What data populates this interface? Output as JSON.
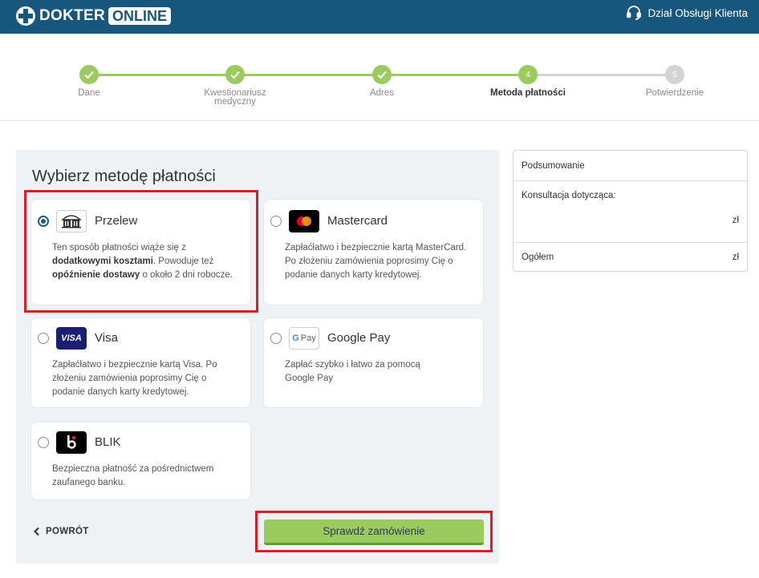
{
  "header": {
    "logo_part1": "DOKTER",
    "logo_part2": "ONLINE",
    "help_label": "Dział Obsługi Klienta",
    "bg_color": "#17577d"
  },
  "stepper": {
    "steps": [
      {
        "label": "Dane",
        "status": "done",
        "number": ""
      },
      {
        "label": "Kwestionariusz medyczny",
        "status": "done",
        "number": ""
      },
      {
        "label": "Adres",
        "status": "done",
        "number": ""
      },
      {
        "label": "Metoda płatności",
        "status": "active",
        "number": "4"
      },
      {
        "label": "Potwierdzenie",
        "status": "pending",
        "number": "5"
      }
    ],
    "done_color": "#9bcb5e",
    "pending_color": "#d3d3d3"
  },
  "payment": {
    "title": "Wybierz metodę płatności",
    "methods": [
      {
        "name": "Przelew",
        "icon": "bank-icon",
        "selected": true,
        "desc_parts": [
          "Ten sposób płatności wiąże się z ",
          "dodatkowymi kosztami",
          ". Powoduje też ",
          "opóźnienie dostawy",
          " o około 2 dni robocze."
        ]
      },
      {
        "name": "Mastercard",
        "icon": "mastercard-icon",
        "selected": false,
        "desc": "Zapłaćłatwo i bezpiecznie kartą MasterCard. Po złożeniu zamówienia poprosimy Cię o podanie danych karty kredytowej."
      },
      {
        "name": "Visa",
        "icon": "visa-icon",
        "selected": false,
        "icon_text": "VISA",
        "desc": "Zapłaćłatwo i bezpiecznie kartą Visa. Po złożeniu zamówienia poprosimy Cię o podanie danych karty kredytowej."
      },
      {
        "name": "Google Pay",
        "icon": "google-pay-icon",
        "selected": false,
        "icon_text": "Pay",
        "desc": "Zapłać szybko i łatwo za pomocą Google Pay"
      },
      {
        "name": "BLIK",
        "icon": "blik-icon",
        "selected": false,
        "desc": "Bezpieczna płatność za pośrednictwem zaufanego banku."
      }
    ],
    "back_label": "POWRÓT",
    "submit_label": "Sprawdź zamówienie"
  },
  "summary": {
    "title": "Podsumowanie",
    "consult_label": "Konsultacja dotycząca:",
    "consult_value": "zł",
    "total_label": "Ogółem",
    "total_value": "zł"
  },
  "colors": {
    "accent": "#1d5f85",
    "cta": "#9bcb5e",
    "highlight": "#d81f26"
  }
}
